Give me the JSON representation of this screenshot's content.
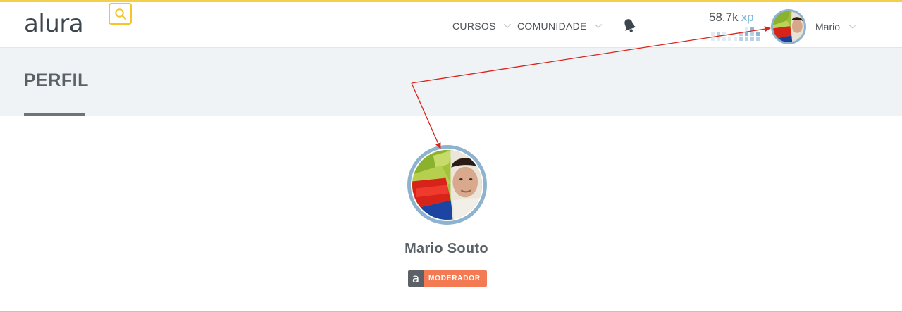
{
  "header": {
    "logo": "alura",
    "nav": {
      "cursos": "CURSOS",
      "comunidade": "COMUNIDADE"
    },
    "xp": {
      "value": "58.7k",
      "unit": "xp"
    },
    "user_name": "Mario"
  },
  "page": {
    "title": "PERFIL"
  },
  "profile": {
    "name": "Mario Souto",
    "badge_icon": "a",
    "badge_label": "MODERADOR"
  },
  "colors": {
    "accent_yellow": "#f3c623",
    "badge_orange": "#f47a54",
    "avatar_ring": "#8eb3cf",
    "annotation_red": "#d9241b"
  },
  "icons": [
    "search-icon",
    "chevron-down-icon",
    "bell-icon",
    "avatar-photo",
    "alura-a-icon"
  ]
}
